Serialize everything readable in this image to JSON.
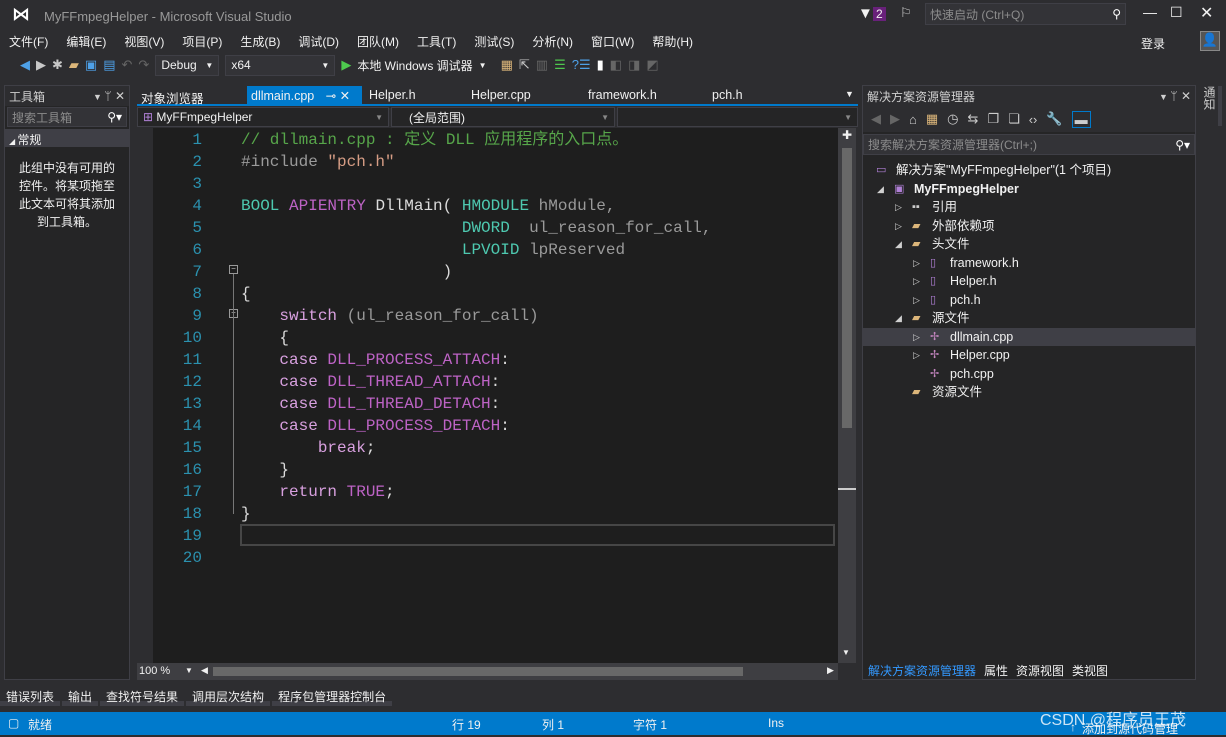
{
  "title": "MyFFmpegHelper - Microsoft Visual Studio",
  "notif_count": "2",
  "quick_launch": "快速启动 (Ctrl+Q)",
  "signin": "登录",
  "menu": [
    "文件(F)",
    "编辑(E)",
    "视图(V)",
    "项目(P)",
    "生成(B)",
    "调试(D)",
    "团队(M)",
    "工具(T)",
    "测试(S)",
    "分析(N)",
    "窗口(W)",
    "帮助(H)"
  ],
  "toolbar": {
    "config": "Debug",
    "platform": "x64",
    "run": "本地 Windows 调试器"
  },
  "toolbox": {
    "title": "工具箱",
    "search": "搜索工具箱",
    "group": "常规",
    "empty": "此组中没有可用的控件。将某项拖至此文本可将其添加到工具箱。"
  },
  "tabs": [
    "对象浏览器",
    "dllmain.cpp",
    "Helper.h",
    "Helper.cpp",
    "framework.h",
    "pch.h"
  ],
  "nav": {
    "project": "MyFFmpegHelper",
    "scope": "(全局范围)"
  },
  "code": [
    [
      [
        "// dllmain.cpp : 定义 DLL 应用程序的入口点。",
        "com"
      ]
    ],
    [
      [
        "#include ",
        "pre"
      ],
      [
        "\"pch.h\"",
        "str"
      ]
    ],
    [],
    [
      [
        "BOOL ",
        "type"
      ],
      [
        "APIENTRY ",
        "mac"
      ],
      [
        "DllMain( ",
        "plain"
      ],
      [
        "HMODULE ",
        "type"
      ],
      [
        "hModule,",
        "par"
      ]
    ],
    [
      [
        "                       ",
        "plain"
      ],
      [
        "DWORD  ",
        "type"
      ],
      [
        "ul_reason_for_call,",
        "par"
      ]
    ],
    [
      [
        "                       ",
        "plain"
      ],
      [
        "LPVOID ",
        "type"
      ],
      [
        "lpReserved",
        "par"
      ]
    ],
    [
      [
        "                     )",
        "plain"
      ]
    ],
    [
      [
        "{",
        "plain"
      ]
    ],
    [
      [
        "    ",
        "plain"
      ],
      [
        "switch ",
        "kw2"
      ],
      [
        "(ul_reason_for_call)",
        "par"
      ]
    ],
    [
      [
        "    {",
        "plain"
      ]
    ],
    [
      [
        "    ",
        "plain"
      ],
      [
        "case ",
        "kw2"
      ],
      [
        "DLL_PROCESS_ATTACH",
        "mac"
      ],
      [
        ":",
        "plain"
      ]
    ],
    [
      [
        "    ",
        "plain"
      ],
      [
        "case ",
        "kw2"
      ],
      [
        "DLL_THREAD_ATTACH",
        "mac"
      ],
      [
        ":",
        "plain"
      ]
    ],
    [
      [
        "    ",
        "plain"
      ],
      [
        "case ",
        "kw2"
      ],
      [
        "DLL_THREAD_DETACH",
        "mac"
      ],
      [
        ":",
        "plain"
      ]
    ],
    [
      [
        "    ",
        "plain"
      ],
      [
        "case ",
        "kw2"
      ],
      [
        "DLL_PROCESS_DETACH",
        "mac"
      ],
      [
        ":",
        "plain"
      ]
    ],
    [
      [
        "        ",
        "plain"
      ],
      [
        "break",
        "kw2"
      ],
      [
        ";",
        "plain"
      ]
    ],
    [
      [
        "    }",
        "plain"
      ]
    ],
    [
      [
        "    ",
        "plain"
      ],
      [
        "return ",
        "kw2"
      ],
      [
        "TRUE",
        "mac"
      ],
      [
        ";",
        "plain"
      ]
    ],
    [
      [
        "}",
        "plain"
      ]
    ],
    [],
    []
  ],
  "zoom": "100 %",
  "solution": {
    "title": "解决方案资源管理器",
    "search": "搜索解决方案资源管理器(Ctrl+;)",
    "items": [
      {
        "label": "解决方案\"MyFFmpegHelper\"(1 个项目)",
        "depth": 0,
        "exp": "",
        "icon": "solution-icon"
      },
      {
        "label": "MyFFmpegHelper",
        "depth": 1,
        "exp": "open",
        "icon": "project-icon",
        "bold": true
      },
      {
        "label": "引用",
        "depth": 2,
        "exp": "closed",
        "icon": "references-icon"
      },
      {
        "label": "外部依赖项",
        "depth": 2,
        "exp": "closed",
        "icon": "external-deps-icon"
      },
      {
        "label": "头文件",
        "depth": 2,
        "exp": "open",
        "icon": "folder-icon"
      },
      {
        "label": "framework.h",
        "depth": 3,
        "exp": "closed",
        "icon": "header-file-icon"
      },
      {
        "label": "Helper.h",
        "depth": 3,
        "exp": "closed",
        "icon": "header-file-icon"
      },
      {
        "label": "pch.h",
        "depth": 3,
        "exp": "closed",
        "icon": "header-file-icon"
      },
      {
        "label": "源文件",
        "depth": 2,
        "exp": "open",
        "icon": "folder-icon"
      },
      {
        "label": "dllmain.cpp",
        "depth": 3,
        "exp": "closed",
        "icon": "cpp-file-icon",
        "selected": true
      },
      {
        "label": "Helper.cpp",
        "depth": 3,
        "exp": "closed",
        "icon": "cpp-file-icon"
      },
      {
        "label": "pch.cpp",
        "depth": 3,
        "exp": "",
        "icon": "cpp-file-icon"
      },
      {
        "label": "资源文件",
        "depth": 2,
        "exp": "",
        "icon": "folder-icon"
      }
    ],
    "bottom_tabs": [
      "解决方案资源管理器",
      "属性",
      "资源视图",
      "类视图"
    ]
  },
  "notify_strip": "通知",
  "tool_tabs": [
    "错误列表",
    "输出",
    "查找符号结果",
    "调用层次结构",
    "程序包管理器控制台"
  ],
  "status": {
    "ready": "就绪",
    "line": "行 19",
    "col": "列 1",
    "char": "字符 1",
    "ins": "Ins",
    "source_control": "添加到源代码管理",
    "watermark": "CSDN @程序员王茂"
  },
  "colors": {
    "accent": "#007acc",
    "editor_bg": "#1e1e1e",
    "line_number": "#2b91af"
  }
}
